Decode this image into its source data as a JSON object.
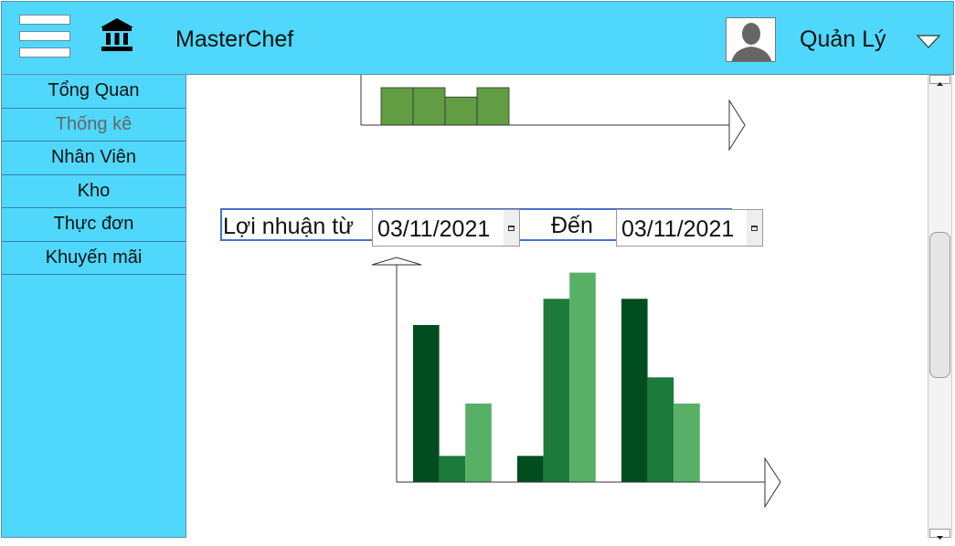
{
  "header": {
    "app_title": "MasterChef",
    "user_name": "Quản Lý"
  },
  "sidebar": {
    "items": [
      {
        "label": "Tổng Quan"
      },
      {
        "label": "Thống kê"
      },
      {
        "label": "Nhân Viên"
      },
      {
        "label": "Kho"
      },
      {
        "label": "Thực đơn"
      },
      {
        "label": "Khuyến mãi"
      }
    ],
    "active_index": 1
  },
  "filter": {
    "label": "Lợi nhuận từ",
    "from_date": "03/11/2021",
    "to_label": "Đến",
    "to_date": "03/11/2021"
  },
  "colors": {
    "header_bg": "#4fd8fb",
    "series_dark": "#004d20",
    "series_mid": "#1c7a3a",
    "series_light": "#58b066",
    "top_chart_bar": "#629d44"
  },
  "chart_data": [
    {
      "type": "bar",
      "note_partial": true,
      "values": [
        4,
        4,
        3,
        4
      ]
    },
    {
      "type": "bar",
      "categories": [
        "",
        "",
        ""
      ],
      "series": [
        {
          "values": [
            6,
            1,
            7
          ]
        },
        {
          "values": [
            1,
            7,
            4
          ]
        },
        {
          "values": [
            3,
            8,
            3
          ]
        }
      ],
      "ylim": [
        0,
        8.3
      ]
    }
  ]
}
